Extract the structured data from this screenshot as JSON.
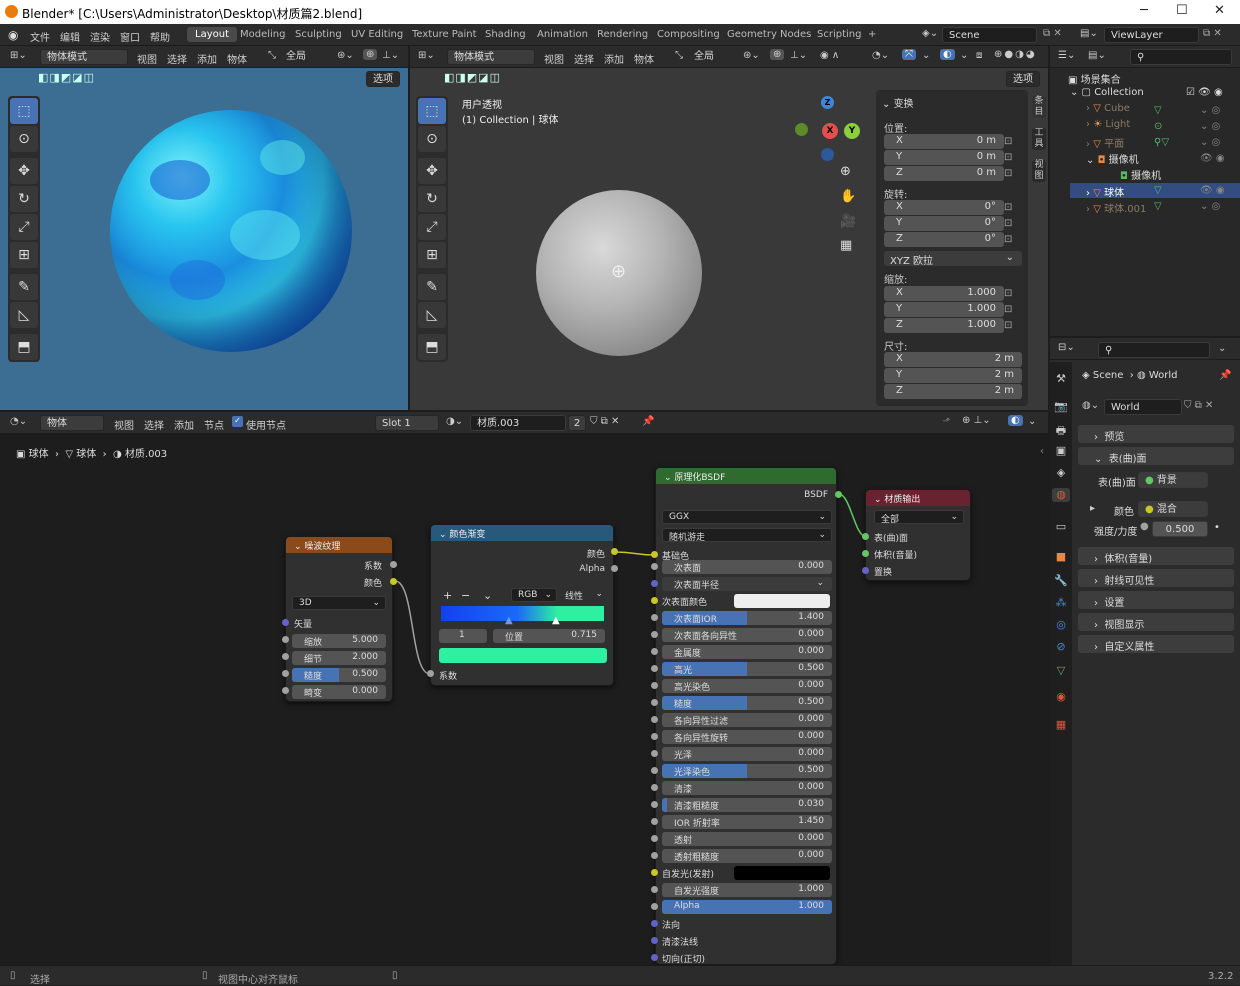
{
  "window": {
    "title": "Blender* [C:\\Users\\Administrator\\Desktop\\材质篇2.blend]",
    "controls": [
      "─",
      "☐",
      "✕"
    ]
  },
  "menu": [
    "文件",
    "编辑",
    "渲染",
    "窗口",
    "帮助"
  ],
  "workspaces": [
    "Layout",
    "Modeling",
    "Sculpting",
    "UV Editing",
    "Texture Paint",
    "Shading",
    "Animation",
    "Rendering",
    "Compositing",
    "Geometry Nodes",
    "Scripting",
    "+"
  ],
  "active_workspace": "Layout",
  "scene": "Scene",
  "viewlayer": "ViewLayer",
  "viewport_left": {
    "mode": "物体模式",
    "menus": [
      "视图",
      "选择",
      "添加",
      "物体"
    ],
    "orientation": "全局",
    "options": "选项"
  },
  "viewport_right": {
    "mode": "物体模式",
    "menus": [
      "视图",
      "选择",
      "添加",
      "物体"
    ],
    "orientation": "全局",
    "options": "选项",
    "view_name": "用户透视",
    "collection_info": "(1) Collection | 球体"
  },
  "transform": {
    "title": "变换",
    "location_label": "位置:",
    "location": {
      "X": "0 m",
      "Y": "0 m",
      "Z": "0 m"
    },
    "rotation_label": "旋转:",
    "rotation": {
      "X": "0°",
      "Y": "0°",
      "Z": "0°"
    },
    "rotation_mode": "XYZ 欧拉",
    "scale_label": "缩放:",
    "scale": {
      "X": "1.000",
      "Y": "1.000",
      "Z": "1.000"
    },
    "dimensions_label": "尺寸:",
    "dimensions": {
      "X": "2 m",
      "Y": "2 m",
      "Z": "2 m"
    }
  },
  "npanel_tabs": [
    "条目",
    "工具",
    "视图"
  ],
  "outliner": {
    "root": "场景集合",
    "collection": "Collection",
    "items": [
      {
        "name": "Cube",
        "dim": true
      },
      {
        "name": "Light",
        "dim": true
      },
      {
        "name": "平面",
        "dim": true
      },
      {
        "name": "摄像机",
        "dim": false
      },
      {
        "name": "摄像机",
        "dim": false,
        "child": true
      },
      {
        "name": "球体",
        "dim": false
      },
      {
        "name": "球体.001",
        "dim": true
      }
    ]
  },
  "node_editor": {
    "type": "物体",
    "menus": [
      "视图",
      "选择",
      "添加",
      "节点"
    ],
    "use_nodes": "使用节点",
    "slot": "Slot 1",
    "material": "材质.003",
    "users": "2",
    "breadcrumb": [
      "球体",
      "球体",
      "材质.003"
    ]
  },
  "noise_node": {
    "title": "噪波纹理",
    "outputs": [
      "系数",
      "颜色"
    ],
    "dimension": "3D",
    "vector": "矢量",
    "fields": [
      {
        "label": "缩放",
        "value": "5.000"
      },
      {
        "label": "细节",
        "value": "2.000"
      },
      {
        "label": "糙度",
        "value": "0.500"
      },
      {
        "label": "畸变",
        "value": "0.000"
      }
    ]
  },
  "ramp_node": {
    "title": "颜色渐变",
    "outputs": [
      "颜色",
      "Alpha"
    ],
    "color_mode": "RGB",
    "interp": "线性",
    "stop_index": "1",
    "pos_label": "位置",
    "pos_value": "0.715",
    "input": "系数",
    "buttons": [
      "+",
      "−",
      "⌄"
    ]
  },
  "bsdf_node": {
    "title": "原理化BSDF",
    "output": "BSDF",
    "distribution": "GGX",
    "subsurface_method": "随机游走",
    "base_color": "基础色",
    "subsurface_radius": "次表面半径",
    "subsurface_color": "次表面颜色",
    "emission": "自发光(发射)",
    "fields": [
      {
        "label": "次表面",
        "value": "0.000",
        "fill": 0
      },
      {
        "label": "次表面IOR",
        "value": "1.400",
        "fill": 0.5
      },
      {
        "label": "次表面各向异性",
        "value": "0.000",
        "fill": 0
      },
      {
        "label": "金属度",
        "value": "0.000",
        "fill": 0
      },
      {
        "label": "高光",
        "value": "0.500",
        "fill": 0.5
      },
      {
        "label": "高光染色",
        "value": "0.000",
        "fill": 0
      },
      {
        "label": "糙度",
        "value": "0.500",
        "fill": 0.5
      },
      {
        "label": "各向异性过滤",
        "value": "0.000",
        "fill": 0
      },
      {
        "label": "各向异性旋转",
        "value": "0.000",
        "fill": 0
      },
      {
        "label": "光泽",
        "value": "0.000",
        "fill": 0
      },
      {
        "label": "光泽染色",
        "value": "0.500",
        "fill": 0.5
      },
      {
        "label": "清漆",
        "value": "0.000",
        "fill": 0
      },
      {
        "label": "清漆粗糙度",
        "value": "0.030",
        "fill": 0.03
      },
      {
        "label": "IOR 折射率",
        "value": "1.450",
        "fill": 0
      },
      {
        "label": "透射",
        "value": "0.000",
        "fill": 0
      },
      {
        "label": "透射粗糙度",
        "value": "0.000",
        "fill": 0
      }
    ],
    "emission_strength": {
      "label": "自发光强度",
      "value": "1.000"
    },
    "alpha": {
      "label": "Alpha",
      "value": "1.000"
    },
    "vec_inputs": [
      "法向",
      "清漆法线",
      "切向(正切)"
    ]
  },
  "output_node": {
    "title": "材质输出",
    "target": "全部",
    "inputs": [
      "表(曲)面",
      "体积(音量)",
      "置换"
    ]
  },
  "properties": {
    "scene": "Scene",
    "world": "World",
    "world_field": "World",
    "sections": [
      "预览",
      "表(曲)面",
      "体积(音量)",
      "射线可见性",
      "设置",
      "视图显示",
      "自定义属性"
    ],
    "surface_label": "表(曲)面",
    "surface_value": "背景",
    "color_label": "颜色",
    "color_value": "混合",
    "strength_label": "强度/力度",
    "strength_value": "0.500"
  },
  "status": {
    "left": "选择",
    "middle": "视图中心对齐鼠标",
    "version": "3.2.2"
  },
  "colors": {
    "accent": "#4772b3",
    "noise_header": "#8a4a1c",
    "ramp_header": "#28597a",
    "bsdf_header": "#2f6b2f",
    "output_header": "#6b2230",
    "ramp_stop_color": "#2ef0a0"
  }
}
